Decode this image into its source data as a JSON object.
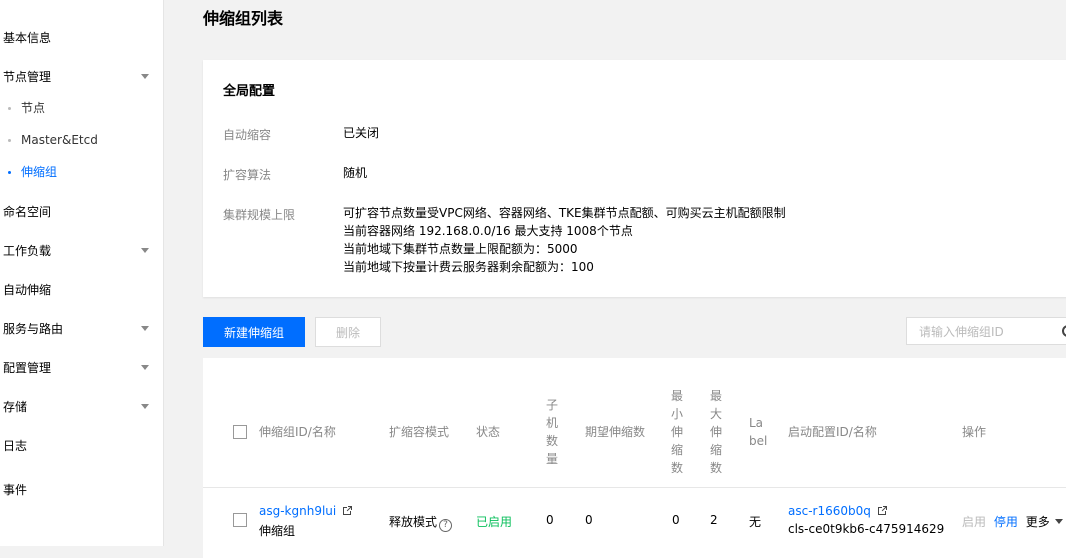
{
  "sidebar": {
    "items": [
      {
        "label": "基本信息"
      },
      {
        "label": "节点管理"
      },
      {
        "label": "节点"
      },
      {
        "label": "Master&Etcd"
      },
      {
        "label": "伸缩组"
      },
      {
        "label": "命名空间"
      },
      {
        "label": "工作负载"
      },
      {
        "label": "自动伸缩"
      },
      {
        "label": "服务与路由"
      },
      {
        "label": "配置管理"
      },
      {
        "label": "存储"
      },
      {
        "label": "日志"
      },
      {
        "label": "事件"
      }
    ]
  },
  "page": {
    "title": "伸缩组列表"
  },
  "global_config": {
    "title": "全局配置",
    "auto_scale_label": "自动缩容",
    "auto_scale_value": "已关闭",
    "algorithm_label": "扩容算法",
    "algorithm_value": "随机",
    "limit_label": "集群规模上限",
    "limit_lines": [
      "可扩容节点数量受VPC网络、容器网络、TKE集群节点配额、可购买云主机配额限制",
      "当前容器网络 192.168.0.0/16 最大支持 1008个节点",
      "当前地域下集群节点数量上限配额为：5000",
      "当前地域下按量计费云服务器剩余配额为：100"
    ]
  },
  "toolbar": {
    "create_label": "新建伸缩组",
    "delete_label": "删除",
    "search_placeholder": "请输入伸缩组ID"
  },
  "table": {
    "headers": {
      "id_name": "伸缩组ID/名称",
      "mode": "扩缩容模式",
      "status": "状态",
      "child_count": "子机数量",
      "desired": "期望伸缩数",
      "min": "最小伸缩数",
      "max": "最大伸缩数",
      "label": "Label",
      "launch_config": "启动配置ID/名称",
      "ops": "操作"
    },
    "rows": [
      {
        "id": "asg-kgnh9lui",
        "name": "伸缩组",
        "mode": "释放模式",
        "status": "已启用",
        "child_count": "0",
        "desired": "0",
        "min": "0",
        "max": "2",
        "label": "无",
        "launch_config_id": "asc-r1660b0q",
        "launch_config_name": "cls-ce0t9kb6-c475914629",
        "op_enable": "启用",
        "op_disable": "停用",
        "op_more": "更多"
      }
    ]
  },
  "colors": {
    "primary": "#006eff",
    "success": "#0abf5b"
  }
}
